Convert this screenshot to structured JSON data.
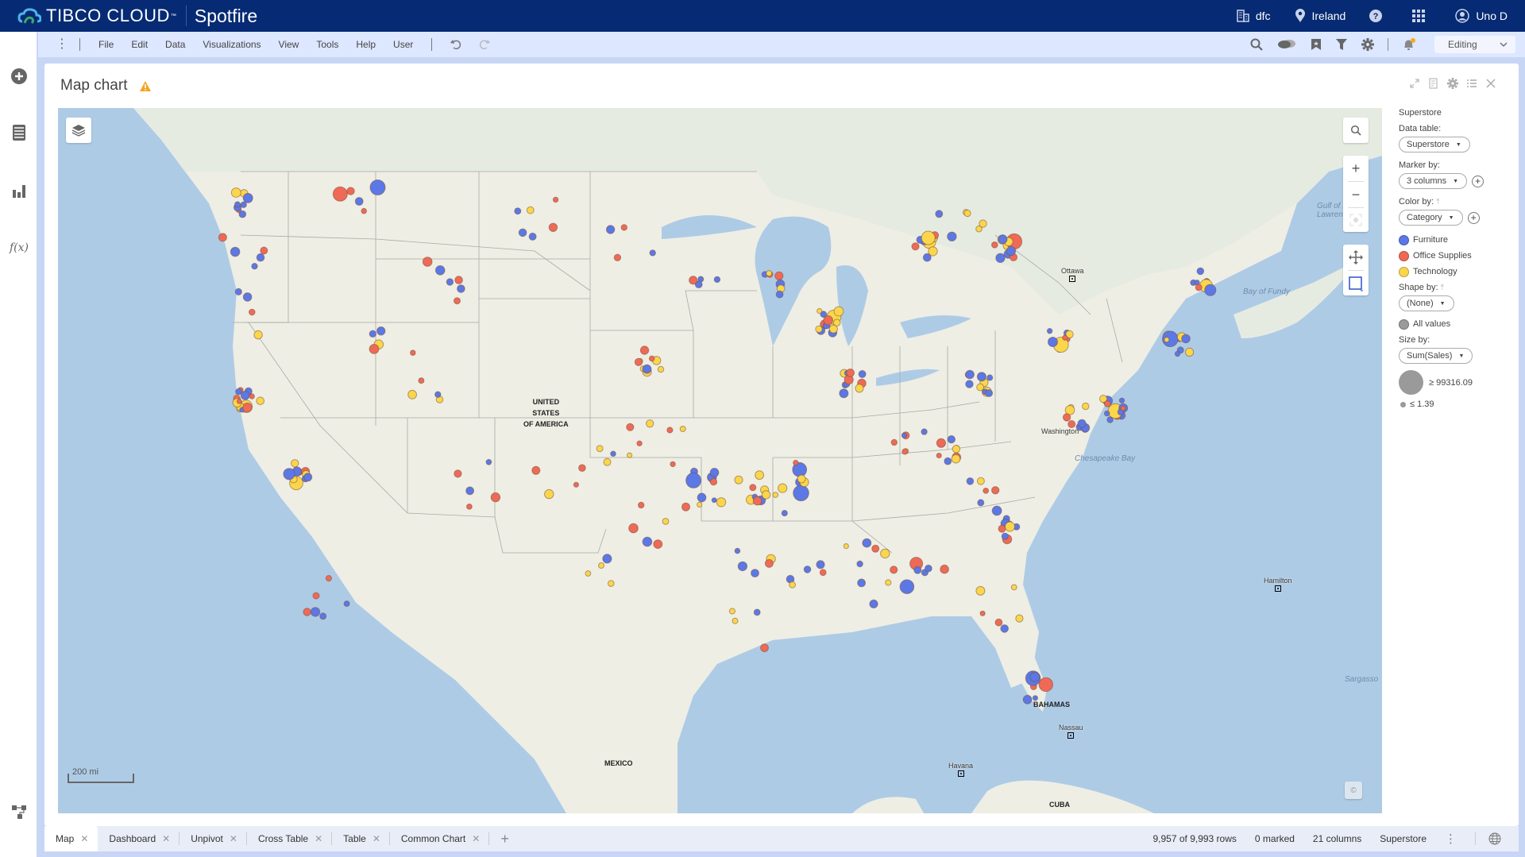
{
  "topbar": {
    "brand": "TIBCO CLOUD",
    "app_name": "Spotfire",
    "org": "dfc",
    "region": "Ireland",
    "user": "Uno D",
    "icons": [
      "building-icon",
      "location-pin-icon",
      "help-icon",
      "apps-grid-icon",
      "user-avatar-icon"
    ]
  },
  "menubar": {
    "items": [
      "File",
      "Edit",
      "Data",
      "Visualizations",
      "View",
      "Tools",
      "Help",
      "User"
    ],
    "mode": "Editing",
    "icons": [
      "search-icon",
      "comments-icon",
      "bookmark-icon",
      "filter-icon",
      "settings-icon",
      "notifications-icon"
    ]
  },
  "leftbar": {
    "icons": [
      "add-icon",
      "data-table-icon",
      "visualization-icon",
      "expression-icon",
      "data-canvas-icon"
    ]
  },
  "visualization": {
    "title": "Map chart",
    "warning": true,
    "header_icons": [
      "maximize-icon",
      "export-icon",
      "properties-icon",
      "legend-toggle-icon",
      "close-icon"
    ],
    "map": {
      "scale_label": "200 mi",
      "labels": {
        "usa": [
          "UNITED",
          "STATES",
          "OF AMERICA"
        ],
        "mexico": "MEXICO",
        "bahamas": "BAHAMAS",
        "cuba": "CUBA"
      },
      "cities": {
        "ottawa": "Ottawa",
        "washington": "Washington",
        "nassau": "Nassau",
        "havana": "Havana",
        "hamilton": "Hamilton"
      },
      "seas": {
        "chesapeake": "Chesapeake Bay",
        "fundy": "Bay of Fundy",
        "gulf_st_lawrence": "Gulf of St. Lawrence",
        "sargasso": "Sargasso"
      },
      "colors": {
        "Furniture": "#5b78e6",
        "Office Supplies": "#ef6a56",
        "Technology": "#fbd64a"
      }
    }
  },
  "legend": {
    "data_source": "Superstore",
    "data_table_label": "Data table:",
    "data_table_value": "Superstore",
    "marker_by_label": "Marker by:",
    "marker_by_value": "3 columns",
    "color_by_label": "Color by:",
    "color_by_value": "Category",
    "categories": [
      {
        "name": "Furniture",
        "color": "#5b78e6"
      },
      {
        "name": "Office Supplies",
        "color": "#ef6a56"
      },
      {
        "name": "Technology",
        "color": "#fbd64a"
      }
    ],
    "shape_by_label": "Shape by:",
    "shape_by_value": "(None)",
    "shape_all": "All values",
    "size_by_label": "Size by:",
    "size_by_value": "Sum(Sales)",
    "size_max": "≥ 99316.09",
    "size_min": "≤ 1.39"
  },
  "tabs": [
    {
      "label": "Map",
      "active": true
    },
    {
      "label": "Dashboard"
    },
    {
      "label": "Unpivot"
    },
    {
      "label": "Cross Table"
    },
    {
      "label": "Table"
    },
    {
      "label": "Common Chart"
    }
  ],
  "status": {
    "rows": "9,957 of 9,993 rows",
    "marked": "0 marked",
    "columns": "21 columns",
    "table": "Superstore"
  }
}
